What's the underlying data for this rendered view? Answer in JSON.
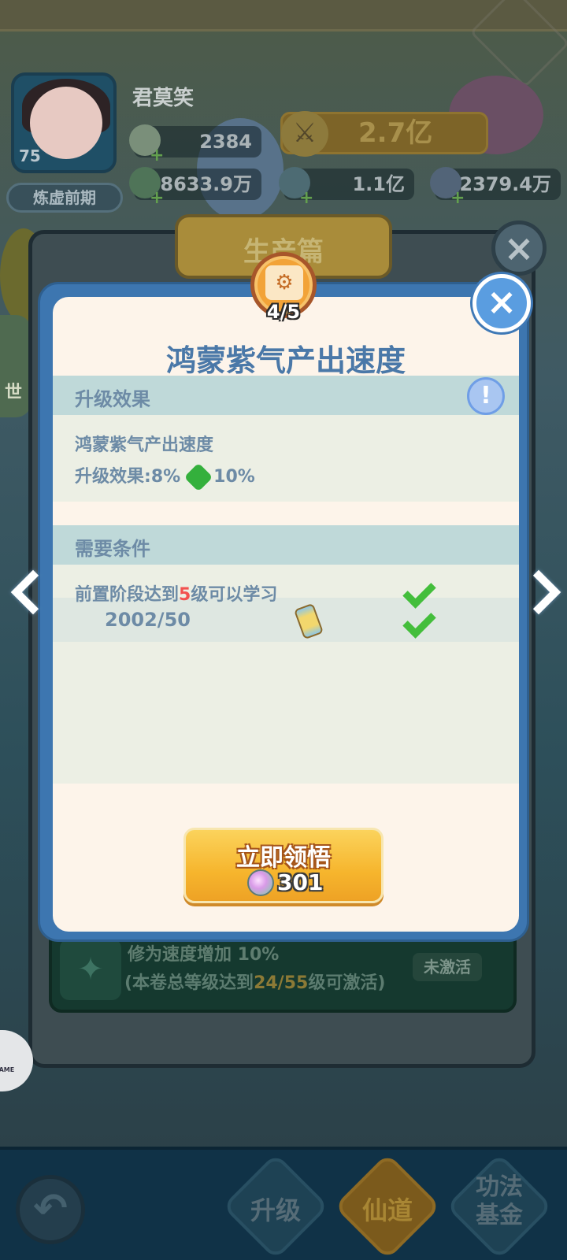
{
  "player": {
    "name": "君莫笑",
    "level": "75",
    "realm": "炼虚前期"
  },
  "resources": {
    "peach": "2384",
    "power": "2.7亿",
    "jade": "8633.9万",
    "crystal": "1.1亿",
    "wing": "2379.4万"
  },
  "background_panel": {
    "header": "生产篇",
    "card_line1": "修为速度增加 10%",
    "card_line2_prefix": "(本卷总等级达到",
    "card_line2_value": "24/55",
    "card_line2_suffix": "级可激活)",
    "card_status": "未激活",
    "side_text": "世"
  },
  "dialog": {
    "badge": "4/5",
    "title": "鸿蒙紫气产出速度",
    "upgrade_section": {
      "label": "升级效果",
      "effect_name": "鸿蒙紫气产出速度",
      "effect_prefix": "升级效果:",
      "from_value": "8%",
      "to_value": "10%"
    },
    "requirements_section": {
      "label": "需要条件",
      "req1_prefix": "前置阶段达到",
      "req1_value": "5",
      "req1_suffix": "级可以学习",
      "req2_value": "2002/50"
    },
    "cta": {
      "label": "立即领悟",
      "cost": "301"
    }
  },
  "bottom_nav": {
    "upgrade": "升级",
    "xiandao": "仙道",
    "fund_line1": "功法",
    "fund_line2": "基金"
  },
  "float_ball": "GAME",
  "colors": {
    "dialog_frame": "#3d76b0",
    "dialog_body": "#fdf4ea",
    "section_band": "#bfd9d9",
    "accent_text": "#4a78a8",
    "cta_gold": "#f6b52d",
    "check_green": "#43be3b",
    "highlight_red": "#f25250"
  },
  "icons": [
    "avatar",
    "peach-icon",
    "sword-icon",
    "jade-icon",
    "crystal-icon",
    "wing-icon",
    "close-icon",
    "info-icon",
    "check-icon",
    "scroll-icon",
    "chevron-left-icon",
    "chevron-right-icon",
    "back-arrow-icon"
  ]
}
